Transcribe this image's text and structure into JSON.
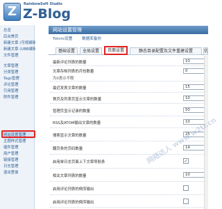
{
  "header": {
    "logo_letter": "Z",
    "studio": "RainbowSoft Studio",
    "brand": "Z-Blog"
  },
  "sidebar": {
    "items": [
      {
        "label": "总览"
      },
      {
        "label": "后台首页"
      },
      {
        "label": "新建文章 (可视编辑)"
      },
      {
        "label": "新建文章 (UBB编辑)"
      },
      {
        "label": "文件管理"
      },
      {
        "label": "文章管理"
      },
      {
        "label": "分类管理"
      },
      {
        "label": "Tags管理"
      },
      {
        "label": "评论管理"
      },
      {
        "label": "引用管理"
      },
      {
        "label": "附件管理"
      },
      {
        "label": "网站设置管理"
      },
      {
        "label": "主题样式管理"
      },
      {
        "label": "插件管理"
      },
      {
        "label": "用户管理"
      },
      {
        "label": "链接管理"
      },
      {
        "label": "日志管理"
      },
      {
        "label": "退出登录"
      }
    ]
  },
  "main": {
    "title": "网站设置管理",
    "subnav": [
      "Totoro设置",
      "数据库备份"
    ],
    "tabs": [
      {
        "label": "基础设置"
      },
      {
        "label": "全局设置"
      },
      {
        "label": "页面设置"
      },
      {
        "label": "静态目录配置及文件重建设置"
      },
      {
        "label": "仿"
      }
    ],
    "rows": [
      {
        "label": "最新评论列表的数量",
        "value": "10",
        "kind": "input"
      },
      {
        "label": "文章存档列表的月份数量",
        "sub": "为0表示不限",
        "value": "0",
        "kind": "input"
      },
      {
        "label": "最近发表文章的数量",
        "value": "15",
        "kind": "input"
      },
      {
        "label": "首页及列表页显示文章的数量",
        "value": "10",
        "kind": "input"
      },
      {
        "label": "管理页显示记录的数量",
        "value": "50",
        "kind": "input"
      },
      {
        "label": "RSS及ATOM输出文章的数量",
        "value": "10",
        "kind": "input"
      },
      {
        "label": "搜索显示文章的数量",
        "value": "25",
        "kind": "input"
      },
      {
        "label": "翻页条的页码数量",
        "value": "14",
        "kind": "input"
      },
      {
        "label": "启用单日志页面上下文章导航条",
        "value": "✓",
        "kind": "check"
      },
      {
        "label": "相关文章列表的数量",
        "value": "10",
        "kind": "input"
      },
      {
        "label": "启用评论列表的倒序输出",
        "value": "",
        "kind": "check"
      },
      {
        "label": "启用评论列表的倒序输出",
        "value": "",
        "kind": "check"
      }
    ]
  },
  "watermark": "网络达人 www.w2tr.cn"
}
